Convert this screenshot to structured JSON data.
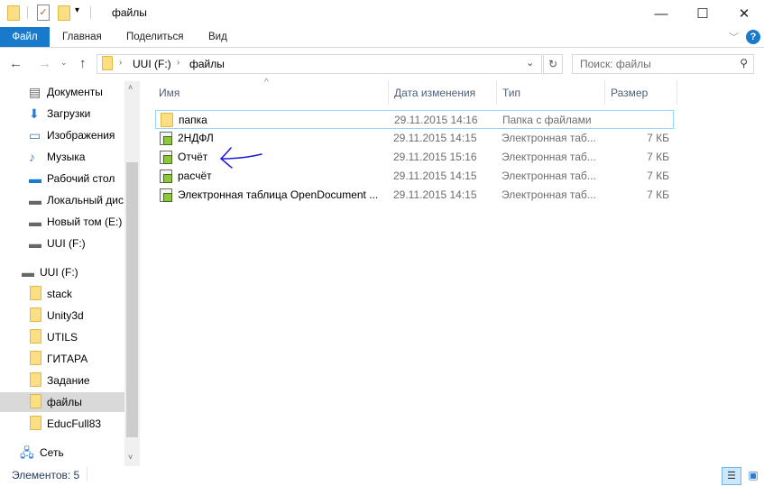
{
  "window": {
    "title": "файлы",
    "minimize": "—",
    "maximize": "☐",
    "close": "✕"
  },
  "ribbon": {
    "tabs": [
      "Файл",
      "Главная",
      "Поделиться",
      "Вид"
    ],
    "help": "?"
  },
  "address": {
    "segments": [
      "UUI (F:)",
      "файлы"
    ],
    "search_placeholder": "Поиск: файлы"
  },
  "sidebar": {
    "quick": [
      "Документы",
      "Загрузки",
      "Изображения",
      "Музыка",
      "Рабочий стол",
      "Локальный дис",
      "Новый том (E:)",
      "UUI (F:)"
    ],
    "drive": "UUI (F:)",
    "folders": [
      "stack",
      "Unity3d",
      "UTILS",
      "ГИТАРА",
      "Задание",
      "файлы",
      "EducFull83"
    ],
    "selected": "файлы",
    "network": "Сеть"
  },
  "columns": {
    "name": "Имя",
    "date": "Дата изменения",
    "type": "Тип",
    "size": "Размер"
  },
  "files": [
    {
      "name": "папка",
      "date": "29.11.2015 14:16",
      "type": "Папка с файлами",
      "size": "",
      "icon": "folder"
    },
    {
      "name": "2НДФЛ",
      "date": "29.11.2015 14:15",
      "type": "Электронная таб...",
      "size": "7 КБ",
      "icon": "spreadsheet"
    },
    {
      "name": "Отчёт",
      "date": "29.11.2015 15:16",
      "type": "Электронная таб...",
      "size": "7 КБ",
      "icon": "spreadsheet"
    },
    {
      "name": "расчёт",
      "date": "29.11.2015 14:15",
      "type": "Электронная таб...",
      "size": "7 КБ",
      "icon": "spreadsheet"
    },
    {
      "name": "Электронная таблица OpenDocument ...",
      "date": "29.11.2015 14:15",
      "type": "Электронная таб...",
      "size": "7 КБ",
      "icon": "spreadsheet"
    }
  ],
  "status": {
    "items": "Элементов: 5"
  },
  "colors": {
    "accent": "#1979ca",
    "selection": "#99d1ff",
    "annotation": "#1a1adb"
  }
}
